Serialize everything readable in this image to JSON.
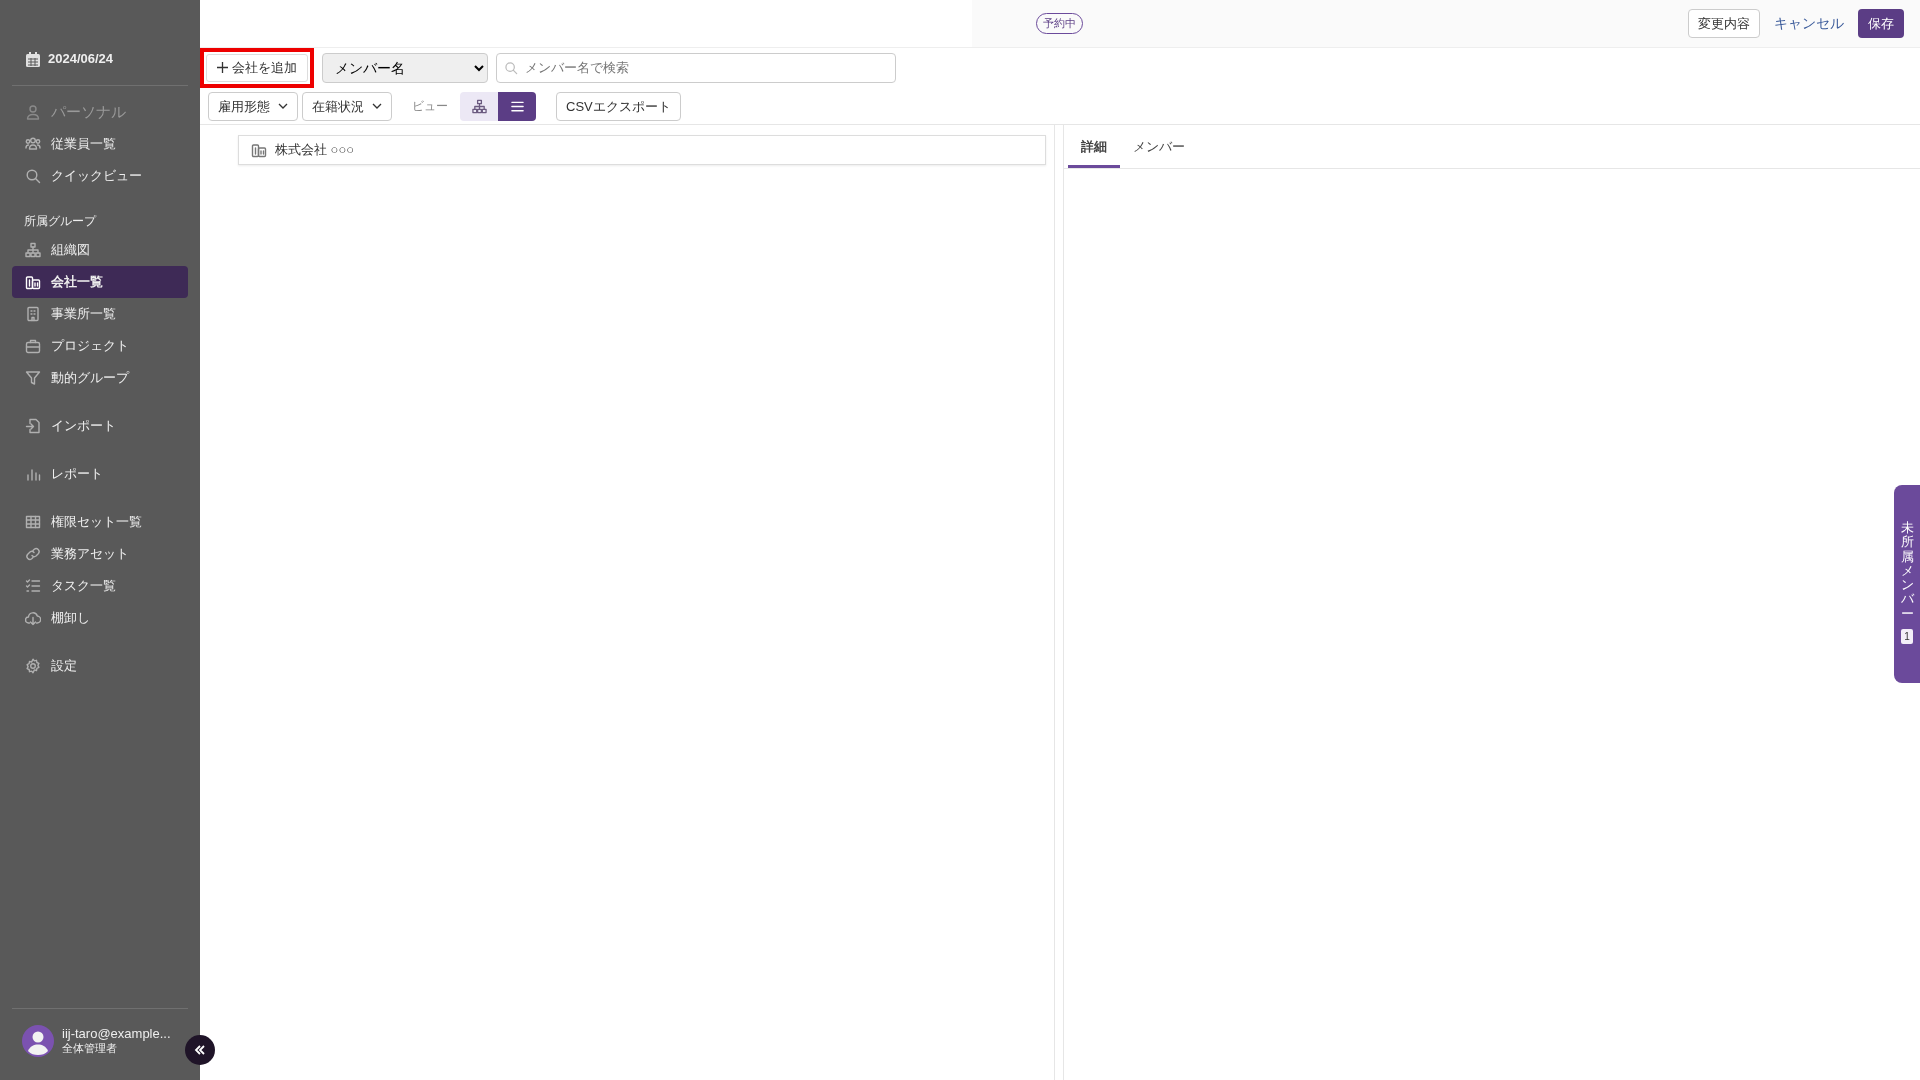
{
  "sidebar": {
    "date": "2024/06/24",
    "groups": [
      {
        "items": [
          {
            "label": "パーソナル",
            "selected": false,
            "disabled": true
          },
          {
            "label": "従業員一覧",
            "selected": false,
            "disabled": false
          },
          {
            "label": "クイックビュー",
            "selected": false,
            "disabled": false
          }
        ]
      },
      {
        "heading": "所属グループ",
        "items": [
          {
            "label": "組織図",
            "selected": false,
            "disabled": false
          },
          {
            "label": "会社一覧",
            "selected": true,
            "disabled": false
          },
          {
            "label": "事業所一覧",
            "selected": false,
            "disabled": false
          },
          {
            "label": "プロジェクト",
            "selected": false,
            "disabled": false
          },
          {
            "label": "動的グループ",
            "selected": false,
            "disabled": false
          }
        ]
      },
      {
        "items": [
          {
            "label": "インポート",
            "selected": false,
            "disabled": false
          }
        ]
      },
      {
        "items": [
          {
            "label": "レポート",
            "selected": false,
            "disabled": false
          }
        ]
      },
      {
        "items": [
          {
            "label": "権限セット一覧",
            "selected": false,
            "disabled": false
          },
          {
            "label": "業務アセット",
            "selected": false,
            "disabled": false
          },
          {
            "label": "タスク一覧",
            "selected": false,
            "disabled": false
          },
          {
            "label": "棚卸し",
            "selected": false,
            "disabled": false
          }
        ]
      },
      {
        "items": [
          {
            "label": "設定",
            "selected": false,
            "disabled": false
          }
        ]
      }
    ],
    "user": {
      "email": "iij-taro@example...",
      "role": "全体管理者"
    }
  },
  "topbar": {
    "badge": "予約中",
    "buttons": [
      {
        "label": "変更内容",
        "kind": "outline"
      },
      {
        "label": "キャンセル",
        "kind": "link"
      },
      {
        "label": "保存",
        "kind": "primary"
      }
    ]
  },
  "toolbar": {
    "add_button": {
      "label": "会社を追加",
      "highlighted": true
    },
    "field_select": {
      "value": "メンバー名"
    },
    "search": {
      "placeholder": "メンバー名で検索"
    },
    "filters": [
      "雇用形態",
      "在籍状況"
    ],
    "view_label": "ビュー",
    "view_options": [
      {
        "kind": "tree",
        "selected": false
      },
      {
        "kind": "list",
        "selected": true
      }
    ],
    "export_button": "CSVエクスポート"
  },
  "tree": {
    "rows": [
      {
        "label": "株式会社 ○○○"
      }
    ]
  },
  "detail_panel": {
    "tabs": [
      {
        "label": "詳細",
        "selected": true
      },
      {
        "label": "メンバー",
        "selected": false
      }
    ]
  },
  "side_tab": {
    "label": "未所属メンバー",
    "count": "1"
  }
}
